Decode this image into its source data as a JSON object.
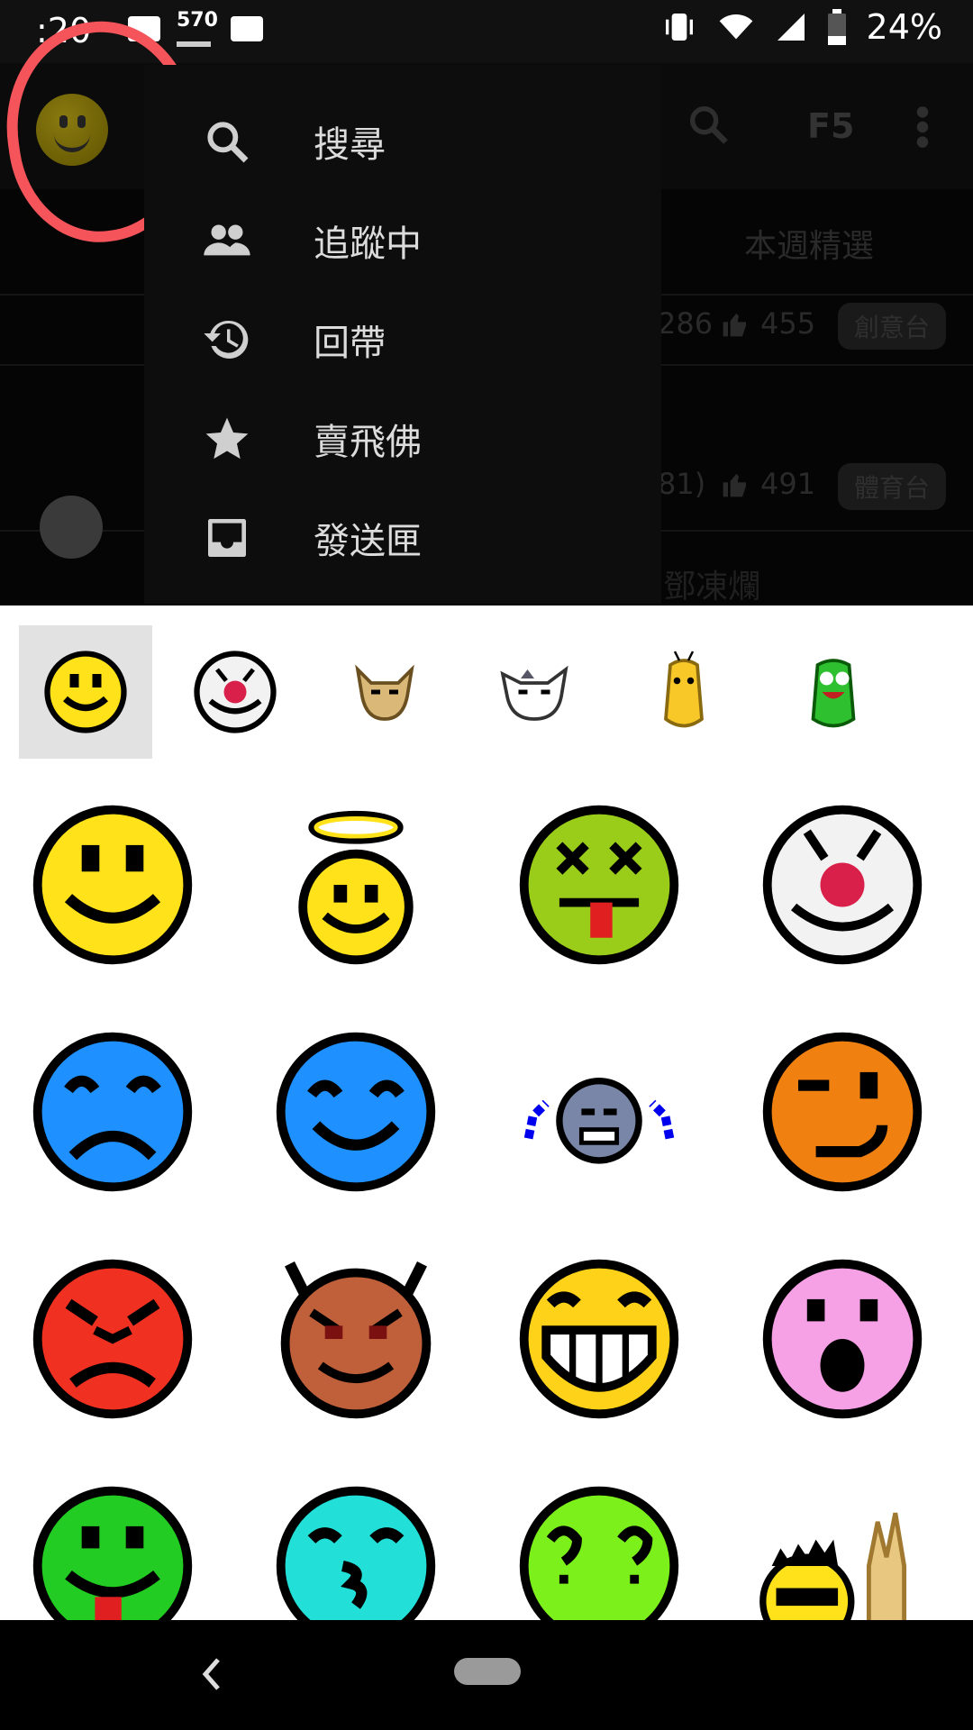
{
  "status_bar": {
    "time": ":20",
    "notif_count": "570",
    "battery": "24%"
  },
  "app_bar": {
    "f5_label": "F5"
  },
  "background_content": {
    "tab_weekly": "本週精選",
    "row1_stats": "286",
    "row1_likes": "455",
    "row1_board": "創意台",
    "row2_stats": "81)",
    "row2_likes": "491",
    "row2_board": "體育台",
    "row3_text": "鄧凍爛"
  },
  "menu": {
    "items": [
      {
        "label": "搜尋",
        "icon": "search-icon"
      },
      {
        "label": "追蹤中",
        "icon": "people-icon"
      },
      {
        "label": "回帶",
        "icon": "history-icon"
      },
      {
        "label": "賣飛佛",
        "icon": "star-icon"
      },
      {
        "label": "發送匣",
        "icon": "inbox-icon"
      }
    ]
  },
  "emoji_picker": {
    "categories": [
      {
        "name": "smiley-category-icon",
        "selected": true
      },
      {
        "name": "clown-category-icon",
        "selected": false
      },
      {
        "name": "dog-category-icon",
        "selected": false
      },
      {
        "name": "cat-category-icon",
        "selected": false
      },
      {
        "name": "yellow-bean-category-icon",
        "selected": false
      },
      {
        "name": "green-bean-category-icon",
        "selected": false
      }
    ],
    "emoji": [
      "smile-emoji-icon",
      "angel-emoji-icon",
      "sick-emoji-icon",
      "clown-emoji-icon",
      "sad-emoji-icon",
      "happy-blue-emoji-icon",
      "crying-emoji-icon",
      "wink-emoji-icon",
      "angry-emoji-icon",
      "devil-emoji-icon",
      "grin-emoji-icon",
      "shocked-emoji-icon",
      "tongue-emoji-icon",
      "kiss-emoji-icon",
      "confused-emoji-icon",
      "rock-emoji-icon"
    ],
    "colors": {
      "yellow": "#ffe21a",
      "green": "#9acd1a",
      "blue": "#1e90ff",
      "orange": "#f08010",
      "red": "#f03020",
      "brown": "#c0603a",
      "pink": "#f6a0e6",
      "bright_green": "#22cc22",
      "cyan": "#22e0d8",
      "lime": "#7cf01a",
      "gray": "#7a86a8"
    }
  },
  "nav_bar": {
    "back_icon": "back-chevron-icon",
    "home_icon": "home-pill-icon"
  }
}
